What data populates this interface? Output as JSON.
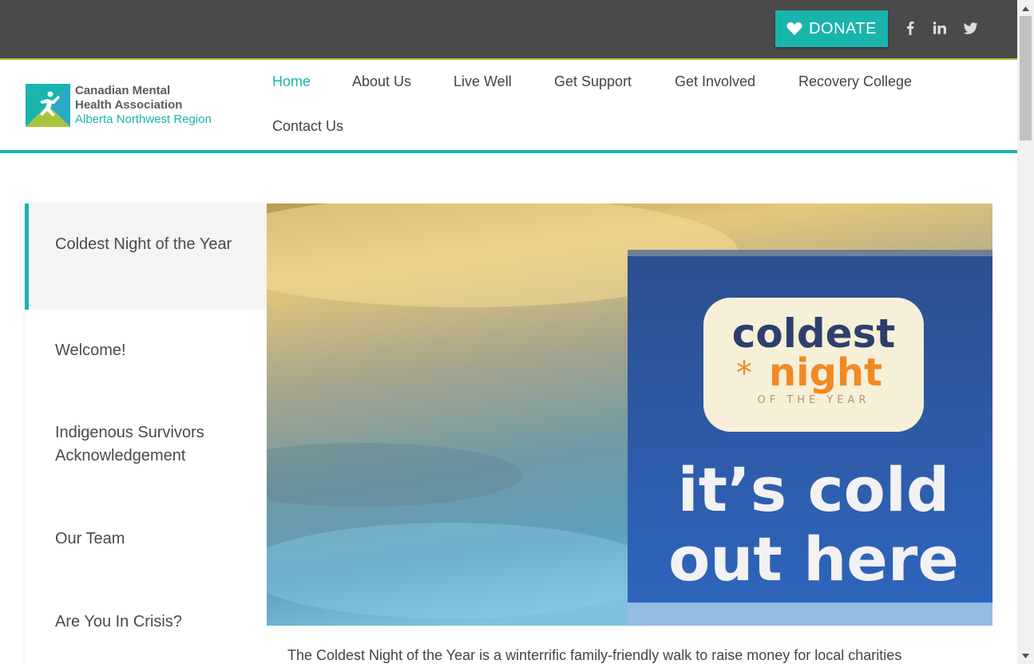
{
  "topbar": {
    "donate_label": "DONATE",
    "social": [
      {
        "name": "facebook",
        "glyph": "f"
      },
      {
        "name": "linkedin",
        "glyph": "in"
      },
      {
        "name": "twitter",
        "glyph": "twitter-bird"
      }
    ]
  },
  "logo": {
    "line1": "Canadian Mental",
    "line2": "Health Association",
    "line3": "Alberta Northwest Region"
  },
  "nav": {
    "items": [
      {
        "label": "Home",
        "active": true
      },
      {
        "label": "About Us"
      },
      {
        "label": "Live Well"
      },
      {
        "label": "Get Support"
      },
      {
        "label": "Get Involved"
      },
      {
        "label": "Recovery College"
      },
      {
        "label": "Contact Us"
      }
    ]
  },
  "sidebar": {
    "items": [
      {
        "label": "Coldest Night of the Year",
        "active": true
      },
      {
        "label": "Welcome!"
      },
      {
        "label": "Indigenous Survivors Acknowledgement"
      },
      {
        "label": "Our Team"
      },
      {
        "label": "Are You In Crisis?"
      }
    ]
  },
  "hero": {
    "sign_line1": "coldest",
    "sign_line2": "night",
    "sign_line3": "OF THE   YEAR",
    "slogan1": "it’s cold",
    "slogan2": "out here"
  },
  "content": {
    "text": "The Coldest Night of the Year is a winterrific family-friendly walk to raise money for local charities"
  },
  "colors": {
    "accent": "#19b5ad",
    "topbar": "#4a4a4a",
    "green": "#a8c43a"
  }
}
